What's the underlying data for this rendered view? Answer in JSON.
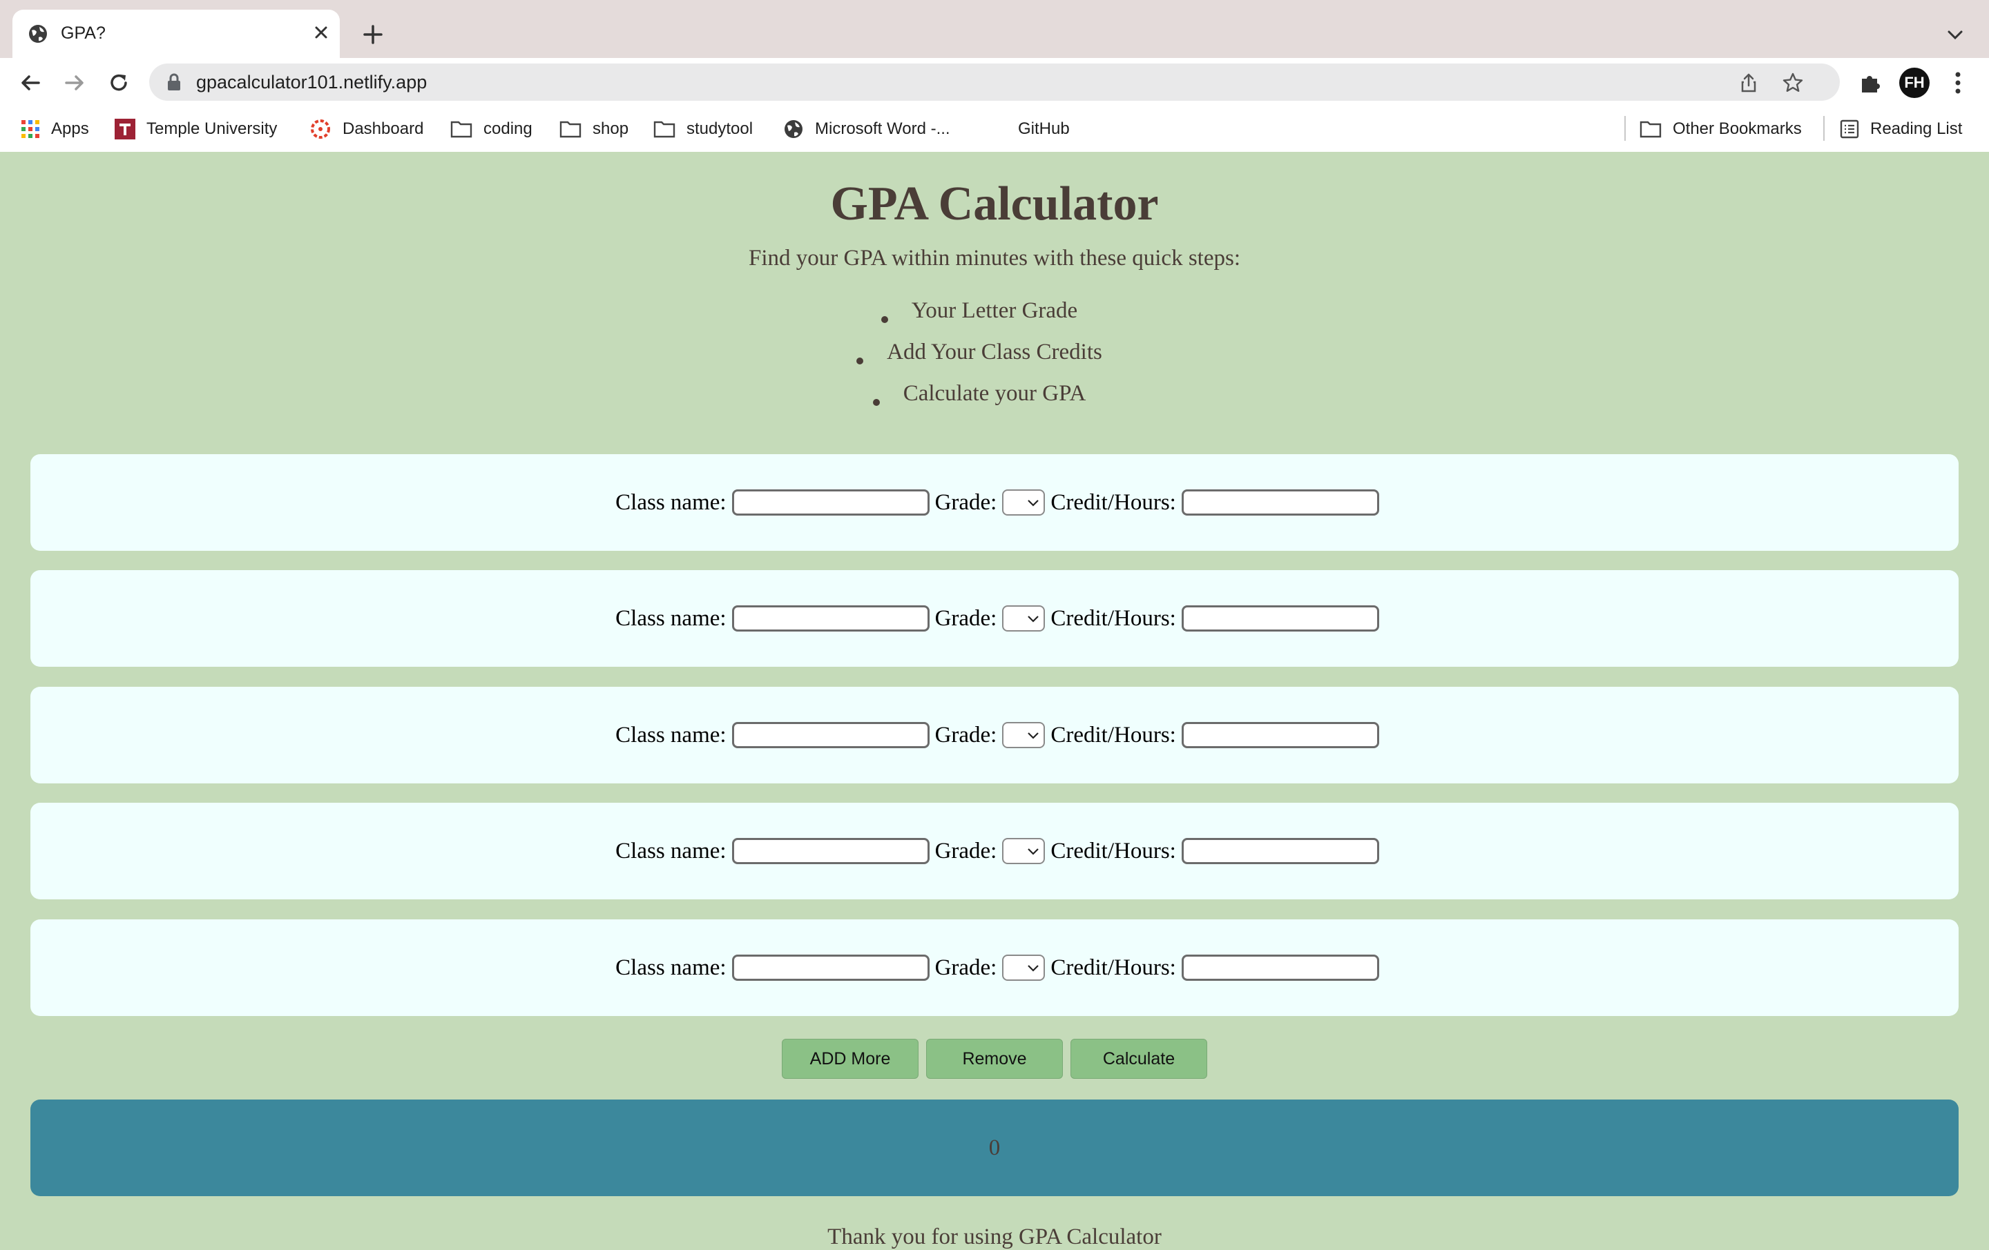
{
  "browser": {
    "tab_title": "GPA?",
    "url": "gpacalculator101.netlify.app",
    "avatar_initials": "FH"
  },
  "bookmarks": {
    "items": [
      "Apps",
      "Temple University",
      "Dashboard",
      "coding",
      "shop",
      "studytool",
      "Microsoft Word -...",
      "GitHub"
    ],
    "other": "Other Bookmarks",
    "reading_list": "Reading List"
  },
  "page": {
    "title": "GPA Calculator",
    "intro": "Find your GPA within minutes with these quick steps:",
    "steps": [
      "Your Letter Grade",
      "Add Your Class Credits",
      "Calculate your GPA"
    ],
    "rows": {
      "class_label": "Class name:",
      "grade_label": "Grade:",
      "credit_label": "Credit/Hours:"
    },
    "buttons": {
      "add": "ADD More",
      "remove": "Remove",
      "calculate": "Calculate"
    },
    "result": "0",
    "footer": "Thank you for using GPA Calculator"
  },
  "colors": {
    "page_bg": "#c5dbb9",
    "row_bg": "#f0fffe",
    "button_bg": "#8bc186",
    "result_bg": "#3c889c",
    "heading_text": "#4a3d37"
  }
}
